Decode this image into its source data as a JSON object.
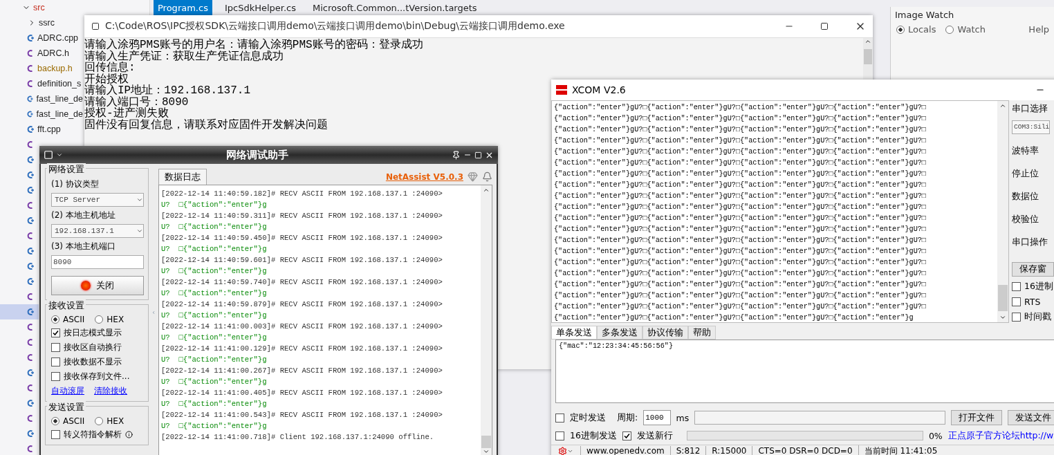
{
  "ide": {
    "tree": [
      {
        "kind": "folder",
        "label": "src",
        "expanded": true,
        "color": "#c42b1c",
        "selected": false
      },
      {
        "kind": "folder",
        "label": "ssrc",
        "expanded": false,
        "selected": false
      },
      {
        "kind": "cpp",
        "label": "ADRC.cpp",
        "selected": false
      },
      {
        "kind": "h",
        "label": "ADRC.h",
        "selected": false
      },
      {
        "kind": "h",
        "label": "backup.h",
        "color": "#9a6a00",
        "selected": false
      },
      {
        "kind": "h",
        "label": "definition_s",
        "selected": false
      },
      {
        "kind": "cpp",
        "label": "fast_line_de",
        "selected": false
      },
      {
        "kind": "cpp",
        "label": "fast_line_de",
        "selected": false
      },
      {
        "kind": "cpp",
        "label": "fft.cpp",
        "selected": false
      },
      {
        "kind": "h",
        "selected": false
      },
      {
        "kind": "cpp",
        "selected": false
      },
      {
        "kind": "cpp",
        "selected": false
      },
      {
        "kind": "cpp",
        "selected": false
      },
      {
        "kind": "h",
        "selected": false
      },
      {
        "kind": "cpp",
        "selected": false
      },
      {
        "kind": "h",
        "selected": false
      },
      {
        "kind": "cpp",
        "selected": false
      },
      {
        "kind": "cpp",
        "selected": false
      },
      {
        "kind": "cpp",
        "selected": false
      },
      {
        "kind": "h",
        "selected": false
      },
      {
        "kind": "cpp",
        "selected": true
      },
      {
        "kind": "h",
        "selected": false
      },
      {
        "kind": "h",
        "selected": false
      },
      {
        "kind": "h",
        "selected": false
      },
      {
        "kind": "cpp",
        "selected": false
      },
      {
        "kind": "h",
        "selected": false
      },
      {
        "kind": "cpp",
        "selected": false
      },
      {
        "kind": "h",
        "selected": false
      },
      {
        "kind": "cpp",
        "selected": false
      },
      {
        "kind": "h",
        "selected": false
      }
    ],
    "editor_tabs": [
      {
        "label": "Program.cs",
        "selected": true
      },
      {
        "label": "IpcSdkHelper.cs",
        "selected": false
      },
      {
        "label": "Microsoft.Common...tVersion.targets",
        "selected": false
      }
    ],
    "image_watch": {
      "title": "Image Watch",
      "options": [
        {
          "label": "Locals",
          "selected": true
        },
        {
          "label": "Watch",
          "selected": false
        }
      ],
      "help": "Help"
    }
  },
  "console": {
    "title": "C:\\Code\\ROS\\IPC授权SDK\\云端接口调用demo\\云端接口调用demo\\bin\\Debug\\云端接口调用demo.exe",
    "lines": [
      "请输入涂鸦PMS账号的用户名：请输入涂鸦PMS账号的密码：登录成功",
      "请输入生产凭证：获取生产凭证信息成功",
      "回传信息:",
      "开始授权",
      "请输入IP地址：192.168.137.1",
      "请输入端口号：8090",
      "授权-进产测失败",
      "固件没有回复信息，请联系对应固件开发解决问题"
    ]
  },
  "netassist": {
    "title": "网络调试助手",
    "network": {
      "title": "网络设置",
      "protocol_label": "(1) 协议类型",
      "protocol": "TCP Server",
      "host_label": "(2) 本地主机地址",
      "host": "192.168.137.1",
      "port_label": "(3) 本地主机端口",
      "port": "8090",
      "close_button": "关闭"
    },
    "receive": {
      "title": "接收设置",
      "encodings": [
        {
          "label": "ASCII",
          "selected": true
        },
        {
          "label": "HEX",
          "selected": false
        }
      ],
      "options": [
        {
          "label": "按日志模式显示",
          "checked": true
        },
        {
          "label": "接收区自动换行",
          "checked": false
        },
        {
          "label": "接收数据不显示",
          "checked": false
        },
        {
          "label": "接收保存到文件...",
          "checked": false
        }
      ],
      "links": [
        "自动滚屏",
        "清除接收"
      ]
    },
    "send": {
      "title": "发送设置",
      "encodings": [
        {
          "label": "ASCII",
          "selected": true
        },
        {
          "label": "HEX",
          "selected": false
        }
      ],
      "options": [
        {
          "label": "转义符指令解析",
          "checked": false
        }
      ]
    },
    "log_tab": "数据日志",
    "brand": "NetAssist V5.0.3",
    "log": [
      {
        "kind": "header",
        "text": "[2022-12-14 11:40:59.182]# RECV ASCII FROM 192.168.137.1 :24090>"
      },
      {
        "kind": "data",
        "text": "U?  □{\"action\":\"enter\"}g"
      },
      {
        "kind": "header",
        "text": "[2022-12-14 11:40:59.311]# RECV ASCII FROM 192.168.137.1 :24090>"
      },
      {
        "kind": "data",
        "text": "U?  □{\"action\":\"enter\"}g"
      },
      {
        "kind": "header",
        "text": "[2022-12-14 11:40:59.450]# RECV ASCII FROM 192.168.137.1 :24090>"
      },
      {
        "kind": "data",
        "text": "U?  □{\"action\":\"enter\"}g"
      },
      {
        "kind": "header",
        "text": "[2022-12-14 11:40:59.601]# RECV ASCII FROM 192.168.137.1 :24090>"
      },
      {
        "kind": "data",
        "text": "U?  □{\"action\":\"enter\"}g"
      },
      {
        "kind": "header",
        "text": "[2022-12-14 11:40:59.740]# RECV ASCII FROM 192.168.137.1 :24090>"
      },
      {
        "kind": "data",
        "text": "U?  □{\"action\":\"enter\"}g"
      },
      {
        "kind": "header",
        "text": "[2022-12-14 11:40:59.879]# RECV ASCII FROM 192.168.137.1 :24090>"
      },
      {
        "kind": "data",
        "text": "U?  □{\"action\":\"enter\"}g"
      },
      {
        "kind": "header",
        "text": "[2022-12-14 11:41:00.003]# RECV ASCII FROM 192.168.137.1 :24090>"
      },
      {
        "kind": "data",
        "text": "U?  □{\"action\":\"enter\"}g"
      },
      {
        "kind": "header",
        "text": "[2022-12-14 11:41:00.129]# RECV ASCII FROM 192.168.137.1 :24090>"
      },
      {
        "kind": "data",
        "text": "U?  □{\"action\":\"enter\"}g"
      },
      {
        "kind": "header",
        "text": "[2022-12-14 11:41:00.267]# RECV ASCII FROM 192.168.137.1 :24090>"
      },
      {
        "kind": "data",
        "text": "U?  □{\"action\":\"enter\"}g"
      },
      {
        "kind": "header",
        "text": "[2022-12-14 11:41:00.405]# RECV ASCII FROM 192.168.137.1 :24090>"
      },
      {
        "kind": "data",
        "text": "U?  □{\"action\":\"enter\"}g"
      },
      {
        "kind": "header",
        "text": "[2022-12-14 11:41:00.543]# RECV ASCII FROM 192.168.137.1 :24090>"
      },
      {
        "kind": "data",
        "text": "U?  □{\"action\":\"enter\"}g"
      },
      {
        "kind": "status",
        "text": "[2022-12-14 11:41:00.718]# Client 192.168.137.1:24090 offline."
      }
    ]
  },
  "xcom": {
    "title": "XCOM V2.6",
    "receive_lines": [
      "{\"action\":\"enter\"}gU?□{\"action\":\"enter\"}gU?□{\"action\":\"enter\"}gU?□{\"action\":\"enter\"}gU?□",
      "{\"action\":\"enter\"}gU?□{\"action\":\"enter\"}gU?□{\"action\":\"enter\"}gU?□{\"action\":\"enter\"}gU?□",
      "{\"action\":\"enter\"}gU?□{\"action\":\"enter\"}gU?□{\"action\":\"enter\"}gU?□{\"action\":\"enter\"}gU?□",
      "{\"action\":\"enter\"}gU?□{\"action\":\"enter\"}gU?□{\"action\":\"enter\"}gU?□{\"action\":\"enter\"}gU?□",
      "{\"action\":\"enter\"}gU?□{\"action\":\"enter\"}gU?□{\"action\":\"enter\"}gU?□{\"action\":\"enter\"}gU?□",
      "{\"action\":\"enter\"}gU?□{\"action\":\"enter\"}gU?□{\"action\":\"enter\"}gU?□{\"action\":\"enter\"}gU?□",
      "{\"action\":\"enter\"}gU?□{\"action\":\"enter\"}gU?□{\"action\":\"enter\"}gU?□{\"action\":\"enter\"}gU?□",
      "{\"action\":\"enter\"}gU?□{\"action\":\"enter\"}gU?□{\"action\":\"enter\"}gU?□{\"action\":\"enter\"}gU?□",
      "{\"action\":\"enter\"}gU?□{\"action\":\"enter\"}gU?□{\"action\":\"enter\"}gU?□{\"action\":\"enter\"}gU?□",
      "{\"action\":\"enter\"}gU?□{\"action\":\"enter\"}gU?□{\"action\":\"enter\"}gU?□{\"action\":\"enter\"}gU?□",
      "{\"action\":\"enter\"}gU?□{\"action\":\"enter\"}gU?□{\"action\":\"enter\"}gU?□{\"action\":\"enter\"}gU?□",
      "{\"action\":\"enter\"}gU?□{\"action\":\"enter\"}gU?□{\"action\":\"enter\"}gU?□{\"action\":\"enter\"}gU?□",
      "{\"action\":\"enter\"}gU?□{\"action\":\"enter\"}gU?□{\"action\":\"enter\"}gU?□{\"action\":\"enter\"}gU?□",
      "{\"action\":\"enter\"}gU?□{\"action\":\"enter\"}gU?□{\"action\":\"enter\"}gU?□{\"action\":\"enter\"}gU?□",
      "{\"action\":\"enter\"}gU?□{\"action\":\"enter\"}gU?□{\"action\":\"enter\"}gU?□{\"action\":\"enter\"}gU?□",
      "{\"action\":\"enter\"}gU?□{\"action\":\"enter\"}gU?□{\"action\":\"enter\"}gU?□{\"action\":\"enter\"}gU?□",
      "{\"action\":\"enter\"}gU?□{\"action\":\"enter\"}gU?□{\"action\":\"enter\"}gU?□{\"action\":\"enter\"}gU?□",
      "{\"action\":\"enter\"}gU?□{\"action\":\"enter\"}gU?□{\"action\":\"enter\"}gU?□{\"action\":\"enter\"}gU?□",
      "{\"action\":\"enter\"}gU?□{\"action\":\"enter\"}gU?□{\"action\":\"enter\"}gU?□{\"action\":\"enter\"}gU?□",
      "{\"action\":\"enter\"}gU?□{\"action\":\"enter\"}gU?□{\"action\":\"enter\"}gU?□{\"action\":\"enter\"}g"
    ],
    "side": {
      "port_label": "串口选择",
      "port": "COM3:Sili",
      "labels": [
        "波特率",
        "停止位",
        "数据位",
        "校验位",
        "串口操作"
      ],
      "save_button": "保存窗",
      "options": [
        {
          "label": "16进制",
          "checked": false
        },
        {
          "label": "RTS",
          "checked": false
        },
        {
          "label": "时间戳",
          "checked": false
        }
      ]
    },
    "tabs": [
      {
        "label": "单条发送",
        "selected": true
      },
      {
        "label": "多条发送",
        "selected": false
      },
      {
        "label": "协议传输",
        "selected": false
      },
      {
        "label": "帮助",
        "selected": false
      }
    ],
    "send_text": "{\"mac\":\"12:23:34:45:56:56\"}",
    "timed_send": {
      "label": "定时发送",
      "checked": false
    },
    "period_label": "周期:",
    "period": "1000",
    "period_unit": "ms",
    "open_file": "打开文件",
    "send_file": "发送文件",
    "hex_send": {
      "label": "16进制发送",
      "checked": false
    },
    "newline": {
      "label": "发送新行",
      "checked": true
    },
    "progress": {
      "level": 0,
      "reading": "0%"
    },
    "forum_link": "正点原子官方论坛http://w",
    "status": [
      "www.openedv.com",
      "S:812",
      "R:15000",
      "CTS=0 DSR=0 DCD=0",
      "当前时间 11:41:05"
    ]
  }
}
